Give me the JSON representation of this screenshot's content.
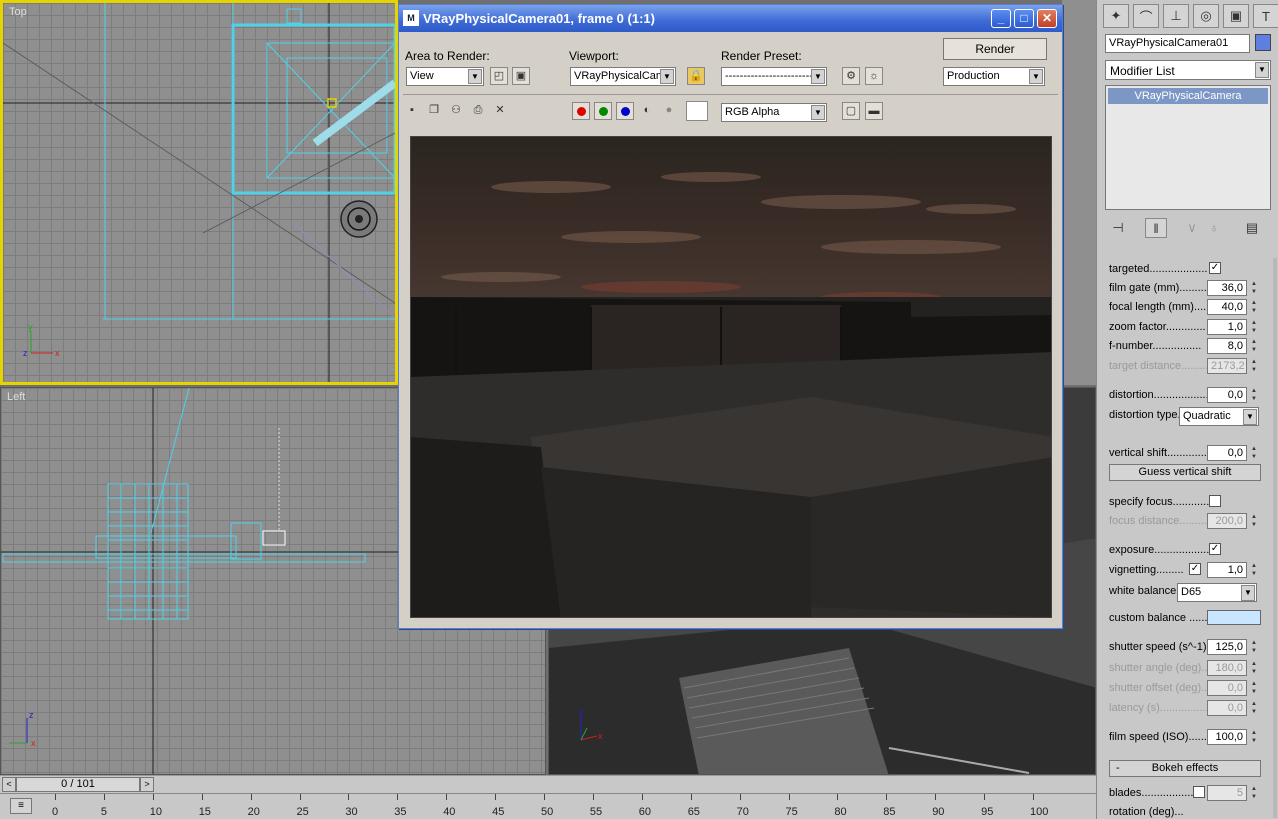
{
  "viewports": {
    "top_label": "Top",
    "left_label": "Left"
  },
  "timeline": {
    "slider_label": "0 / 101",
    "prev_arrow": "<",
    "next_arrow": ">",
    "ticks": [
      "0",
      "5",
      "10",
      "15",
      "20",
      "25",
      "30",
      "35",
      "40",
      "45",
      "50",
      "55",
      "60",
      "65",
      "70",
      "75",
      "80",
      "85",
      "90",
      "95",
      "100"
    ]
  },
  "render_window": {
    "title": "VRayPhysicalCamera01, frame 0 (1:1)",
    "icon_text": "M",
    "minimize": "_",
    "maximize": "□",
    "close": "✕",
    "area_label": "Area to Render:",
    "area_value": "View",
    "viewport_label": "Viewport:",
    "viewport_value": "VRayPhysicalCam",
    "preset_label": "Render Preset:",
    "preset_value": "---------------------------",
    "render_button": "Render",
    "mode_value": "Production",
    "channel_value": "RGB Alpha",
    "channel_colors": {
      "red": "#e00000",
      "green": "#008a00",
      "blue": "#0000d0"
    }
  },
  "command_panel": {
    "object_name": "VRayPhysicalCamera01",
    "object_color": "#5d7fe2",
    "modifier_list": "Modifier List",
    "stack_item": "VRayPhysicalCamera",
    "params": [
      {
        "label": "targeted...................",
        "type": "check",
        "checked": true
      },
      {
        "label": "film gate (mm)..........",
        "value": "36,0"
      },
      {
        "label": "focal length (mm).......",
        "value": "40,0"
      },
      {
        "label": "zoom factor.............",
        "value": "1,0"
      },
      {
        "label": "f-number................",
        "value": "8,0"
      },
      {
        "label": "target distance.........",
        "value": "2173,2",
        "disabled": true
      },
      {
        "label": "distortion..................",
        "value": "0,0"
      },
      {
        "label": "distortion type.",
        "type": "dropdown",
        "value": "Quadratic"
      },
      {
        "label": "vertical shift.............",
        "value": "0,0"
      },
      {
        "label": "Guess vertical shift",
        "type": "button"
      },
      {
        "label": "specify focus.............",
        "type": "check",
        "checked": false
      },
      {
        "label": "focus distance..........",
        "value": "200,0",
        "disabled": true
      },
      {
        "label": "exposure...................",
        "type": "check",
        "checked": true
      },
      {
        "label": "vignetting.........",
        "type": "checkvalue",
        "checked": true,
        "value": "1,0"
      },
      {
        "label": "white balance",
        "type": "dropdown",
        "value": "D65"
      },
      {
        "label": "custom balance ......",
        "type": "swatch",
        "color": "#c8e6ff"
      },
      {
        "label": "shutter speed (s^-1)..",
        "value": "125,0"
      },
      {
        "label": "shutter angle (deg)...",
        "value": "180,0",
        "disabled": true
      },
      {
        "label": "shutter offset (deg)..",
        "value": "0,0",
        "disabled": true
      },
      {
        "label": "latency (s)................",
        "value": "0,0",
        "disabled": true
      },
      {
        "label": "film speed (ISO)........",
        "value": "100,0"
      }
    ],
    "rollout_bokeh": "Bokeh effects",
    "rollout_toggle": "-",
    "blades_label": "blades..................",
    "blades_value": "5",
    "rotation_label": "rotation (deg)..."
  }
}
